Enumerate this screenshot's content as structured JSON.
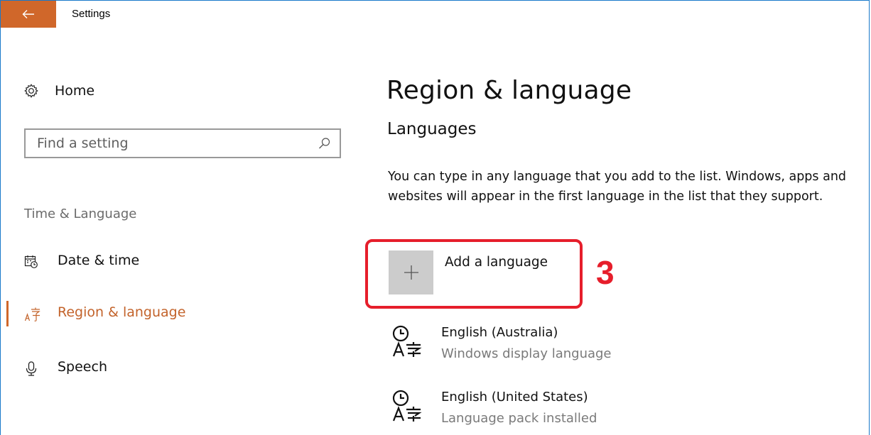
{
  "window": {
    "title": "Settings",
    "accent": "#d0672a"
  },
  "sidebar": {
    "home_label": "Home",
    "search": {
      "placeholder": "Find a setting"
    },
    "section_heading": "Time & Language",
    "items": [
      {
        "label": "Date & time",
        "icon": "calendar-clock-icon",
        "active": false
      },
      {
        "label": "Region & language",
        "icon": "language-icon",
        "active": true
      },
      {
        "label": "Speech",
        "icon": "microphone-icon",
        "active": false
      }
    ]
  },
  "main": {
    "title": "Region & language",
    "subheading": "Languages",
    "description": "You can type in any language that you add to the list. Windows, apps and websites will appear in the first language in the list that they support.",
    "add_language_label": "Add a language",
    "annotation": {
      "step": "3",
      "color": "#e61e2b"
    },
    "languages": [
      {
        "name": "English (Australia)",
        "status": "Windows display language"
      },
      {
        "name": "English (United States)",
        "status": "Language pack installed"
      }
    ]
  }
}
